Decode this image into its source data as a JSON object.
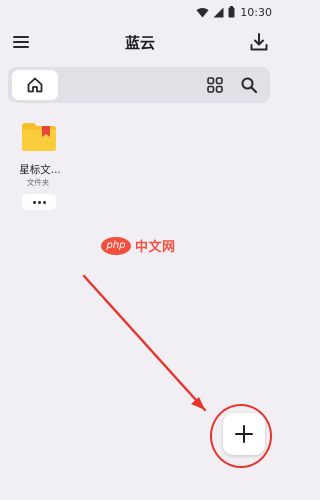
{
  "status_bar": {
    "time": "10:30",
    "icons": [
      "wifi-icon",
      "signal-icon",
      "battery-icon"
    ]
  },
  "app_bar": {
    "title": "蓝云",
    "left_icon": "menu-icon",
    "right_icon": "download-icon"
  },
  "toolbar": {
    "home_icon": "home-icon",
    "grid_icon": "grid-view-icon",
    "search_icon": "search-icon"
  },
  "files": [
    {
      "name": "星标文...",
      "type": "文件夹",
      "icon": "starred-folder-icon",
      "folder_color": "#f6c02b",
      "badge_color": "#e8453c"
    }
  ],
  "fab": {
    "icon": "plus-icon"
  },
  "watermark": {
    "logo_text": "php",
    "text": "中文网"
  },
  "annotation": {
    "color": "#e8342a"
  }
}
